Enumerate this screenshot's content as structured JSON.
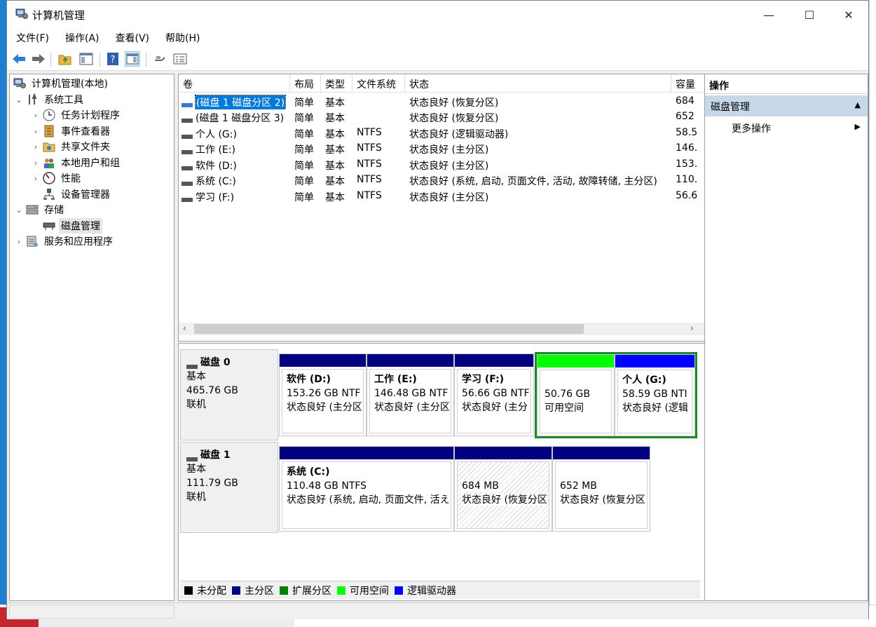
{
  "window": {
    "title": "计算机管理",
    "minimize_glyph": "—",
    "maximize_glyph": "☐",
    "close_glyph": "✕"
  },
  "menu": [
    "文件(F)",
    "操作(A)",
    "查看(V)",
    "帮助(H)"
  ],
  "tree": {
    "root": "计算机管理(本地)",
    "system_tools": "系统工具",
    "task_scheduler": "任务计划程序",
    "event_viewer": "事件查看器",
    "shared_folders": "共享文件夹",
    "local_users": "本地用户和组",
    "performance": "性能",
    "device_manager": "设备管理器",
    "storage": "存储",
    "disk_management": "磁盘管理",
    "services": "服务和应用程序"
  },
  "volume_list": {
    "columns": [
      "卷",
      "布局",
      "类型",
      "文件系统",
      "状态",
      "容量"
    ],
    "rows": [
      [
        "(磁盘 1 磁盘分区 2)",
        "简单",
        "基本",
        "",
        "状态良好 (恢复分区)",
        "684"
      ],
      [
        "(磁盘 1 磁盘分区 3)",
        "简单",
        "基本",
        "",
        "状态良好 (恢复分区)",
        "652"
      ],
      [
        "个人 (G:)",
        "简单",
        "基本",
        "NTFS",
        "状态良好 (逻辑驱动器)",
        "58.5"
      ],
      [
        "工作 (E:)",
        "简单",
        "基本",
        "NTFS",
        "状态良好 (主分区)",
        "146."
      ],
      [
        "软件 (D:)",
        "简单",
        "基本",
        "NTFS",
        "状态良好 (主分区)",
        "153."
      ],
      [
        "系统 (C:)",
        "简单",
        "基本",
        "NTFS",
        "状态良好 (系统, 启动, 页面文件, 活动, 故障转储, 主分区)",
        "110."
      ],
      [
        "学习 (F:)",
        "简单",
        "基本",
        "NTFS",
        "状态良好 (主分区)",
        "56.6"
      ]
    ],
    "scroll_left": "‹",
    "scroll_right": "›"
  },
  "disks": [
    {
      "name": "磁盘 0",
      "type": "基本",
      "size": "465.76 GB",
      "status": "联机",
      "partitions": [
        {
          "name": "软件  (D:)",
          "size": "153.26 GB NTF",
          "status": "状态良好 (主分区",
          "kind": "primary"
        },
        {
          "name": "工作  (E:)",
          "size": "146.48 GB NTF",
          "status": "状态良好 (主分区",
          "kind": "primary"
        },
        {
          "name": "学习  (F:)",
          "size": "56.66 GB NTF",
          "status": "状态良好 (主分",
          "kind": "primary"
        },
        {
          "name": "",
          "size": "50.76 GB",
          "status": "可用空间",
          "kind": "free"
        },
        {
          "name": "个人  (G:)",
          "size": "58.59 GB NTI",
          "status": "状态良好 (逻辑",
          "kind": "logical"
        }
      ]
    },
    {
      "name": "磁盘 1",
      "type": "基本",
      "size": "111.79 GB",
      "status": "联机",
      "partitions": [
        {
          "name": "系统  (C:)",
          "size": "110.48 GB NTFS",
          "status": "状态良好 (系统, 启动, 页面文件, 活え",
          "kind": "primary"
        },
        {
          "name": "",
          "size": "684 MB",
          "status": "状态良好 (恢复分区",
          "kind": "primary"
        },
        {
          "name": "",
          "size": "652 MB",
          "status": "状态良好 (恢复分区",
          "kind": "primary"
        }
      ]
    }
  ],
  "legend": [
    {
      "label": "未分配",
      "color": "#000000"
    },
    {
      "label": "主分区",
      "color": "#000080"
    },
    {
      "label": "扩展分区",
      "color": "#008000"
    },
    {
      "label": "可用空间",
      "color": "#00ff00"
    },
    {
      "label": "逻辑驱动器",
      "color": "#0000ff"
    }
  ],
  "colors": {
    "primary": "#000080",
    "free": "#00ff00",
    "logical": "#0000ff",
    "selection_border": "#1c8a2c",
    "list_selection": "#0078d7"
  },
  "actions": {
    "header": "操作",
    "section": "磁盘管理",
    "section_glyph": "▲",
    "more": "更多操作",
    "more_glyph": "▶"
  }
}
